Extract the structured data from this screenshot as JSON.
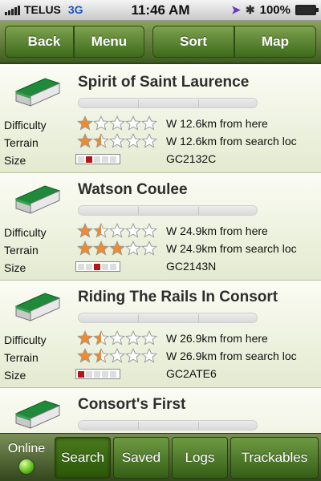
{
  "status_bar": {
    "carrier": "TELUS",
    "network": "3G",
    "time": "11:46 AM",
    "battery": "100%",
    "icons": [
      "signal-icon",
      "location-arrow-icon",
      "bluetooth-icon",
      "battery-icon"
    ]
  },
  "toolbar": {
    "back_label": "Back",
    "menu_label": "Menu",
    "sort_label": "Sort",
    "map_label": "Map"
  },
  "caches": [
    {
      "name": "Spirit of Saint Laurence",
      "difficulty_label": "Difficulty",
      "terrain_label": "Terrain",
      "size_label": "Size",
      "difficulty_stars": 1,
      "terrain_stars": 1.5,
      "size_level": 2,
      "distance_from_here": "W 12.6km from here",
      "distance_from_search": "W 12.6km from search loc",
      "code": "GC2132C"
    },
    {
      "name": "Watson Coulee",
      "difficulty_label": "Difficulty",
      "terrain_label": "Terrain",
      "size_label": "Size",
      "difficulty_stars": 1.5,
      "terrain_stars": 3,
      "size_level": 3,
      "distance_from_here": "W 24.9km from here",
      "distance_from_search": "W 24.9km from search loc",
      "code": "GC2143N"
    },
    {
      "name": "Riding The Rails In Consort",
      "difficulty_label": "Difficulty",
      "terrain_label": "Terrain",
      "size_label": "Size",
      "difficulty_stars": 1.5,
      "terrain_stars": 1.5,
      "size_level": 1,
      "distance_from_here": "W 26.9km from here",
      "distance_from_search": "W 26.9km from search loc",
      "code": "GC2ATE6"
    },
    {
      "name": "Consort's First"
    }
  ],
  "bottom_bar": {
    "online_label": "Online",
    "tabs": [
      "Search",
      "Saved",
      "Logs",
      "Trackables"
    ],
    "active_tab": "Search"
  },
  "colors": {
    "toolbar_green": "#4f7226",
    "star_orange": "#f08a2c",
    "size_red": "#b01818",
    "online_green": "#5fbc18"
  }
}
